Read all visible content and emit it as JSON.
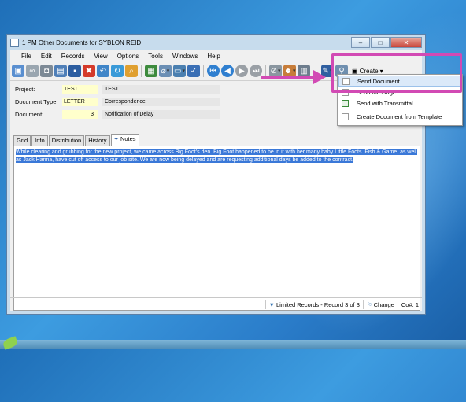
{
  "window": {
    "title": "1 PM Other Documents for SYBLON REID"
  },
  "menu": [
    "File",
    "Edit",
    "Records",
    "View",
    "Options",
    "Tools",
    "Windows",
    "Help"
  ],
  "toolbar": {
    "create_label": "Create"
  },
  "form": {
    "project_label": "Project:",
    "project_code": "TEST.",
    "project_desc": "TEST",
    "doctype_label": "Document Type:",
    "doctype_code": "LETTER",
    "doctype_desc": "Correspondence",
    "document_label": "Document:",
    "document_num": "3",
    "document_desc": "Notification of Delay"
  },
  "tabs": [
    "Grid",
    "Info",
    "Distribution",
    "History",
    "Notes"
  ],
  "notes_text": "While clearing and grubbing for the new project, we came across Big Foot's den.  Big Foot happened to be in it with her many baby Little Foots.  Fish & Game, as well as Jack Hanna, have cut off access to our job site.  We are now being delayed and are requesting additional days be added to the contract.",
  "dropdown": [
    {
      "label": "Send Document",
      "highlighted": true
    },
    {
      "label": "Send Message"
    },
    {
      "label": "Send with Transmittal"
    },
    {
      "label": "Create Document from Template"
    }
  ],
  "status": {
    "records": "Limited Records - Record 3 of 3",
    "change": "Change",
    "company": "Co#: 1"
  },
  "colors": {
    "accent": "#d24ab4",
    "selection": "#3a78d8",
    "yellow_field": "#ffffcc"
  }
}
